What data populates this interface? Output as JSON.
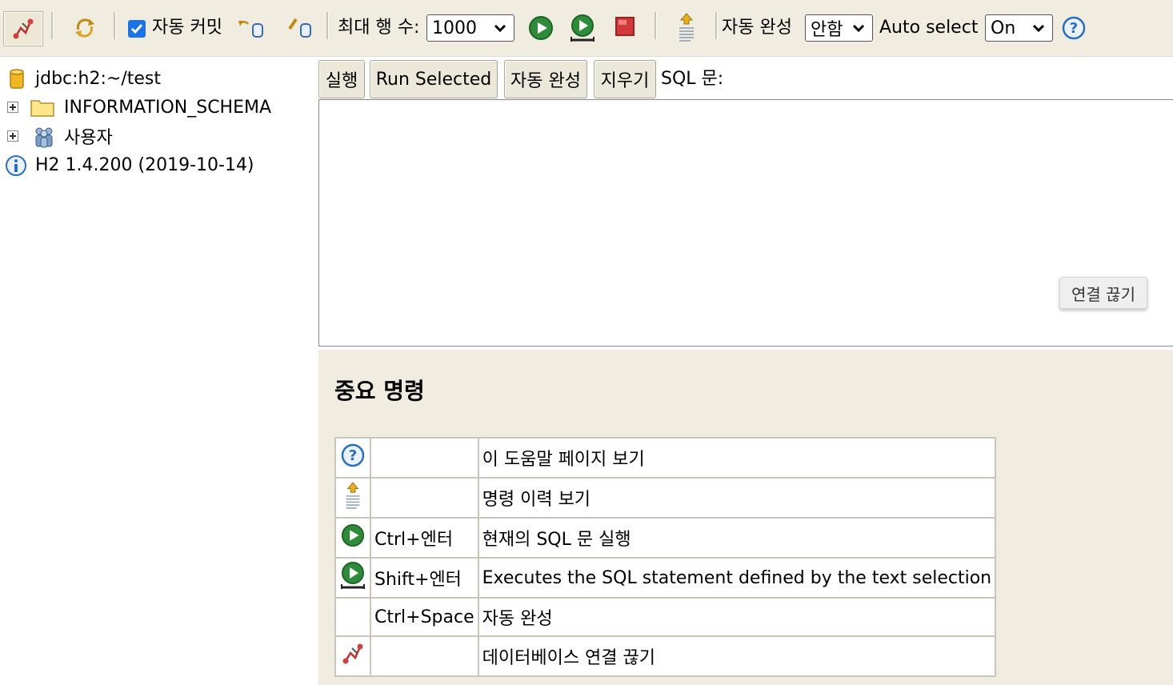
{
  "toolbar": {
    "autocommit_label": "자동 커밋",
    "autocommit_checked": true,
    "max_rows_label": "최대 행 수:",
    "max_rows_value": "1000",
    "autocomplete_label": "자동 완성",
    "autocomplete_value": "안함",
    "autoselect_label": "Auto select",
    "autoselect_value": "On"
  },
  "tree": {
    "connection": "jdbc:h2:~/test",
    "schema": "INFORMATION_SCHEMA",
    "users": "사용자",
    "version": "H2 1.4.200 (2019-10-14)"
  },
  "query": {
    "run_label": "실행",
    "run_selected_label": "Run Selected",
    "autocomplete_label": "자동 완성",
    "clear_label": "지우기",
    "sql_label": "SQL 문:",
    "sql_text": "",
    "disconnect_label": "연결 끊기"
  },
  "help": {
    "title": "중요 명령",
    "rows": [
      {
        "icon": "help-icon",
        "key": "",
        "desc": "이 도움말 페이지 보기"
      },
      {
        "icon": "history-icon",
        "key": "",
        "desc": "명령 이력 보기"
      },
      {
        "icon": "run-icon",
        "key": "Ctrl+엔터",
        "desc": "현재의 SQL 문 실행"
      },
      {
        "icon": "run-selected-icon",
        "key": "Shift+엔터",
        "desc": "Executes the SQL statement defined by the text selection"
      },
      {
        "icon": "",
        "key": "Ctrl+Space",
        "desc": "자동 완성"
      },
      {
        "icon": "disconnect-icon",
        "key": "",
        "desc": "데이터베이스 연결 끊기"
      }
    ]
  },
  "colors": {
    "toolbar_bg": "#f0ede0",
    "run_green": "#2e8b3a",
    "stop_red": "#d23a3a",
    "help_blue": "#2a6fc0"
  }
}
